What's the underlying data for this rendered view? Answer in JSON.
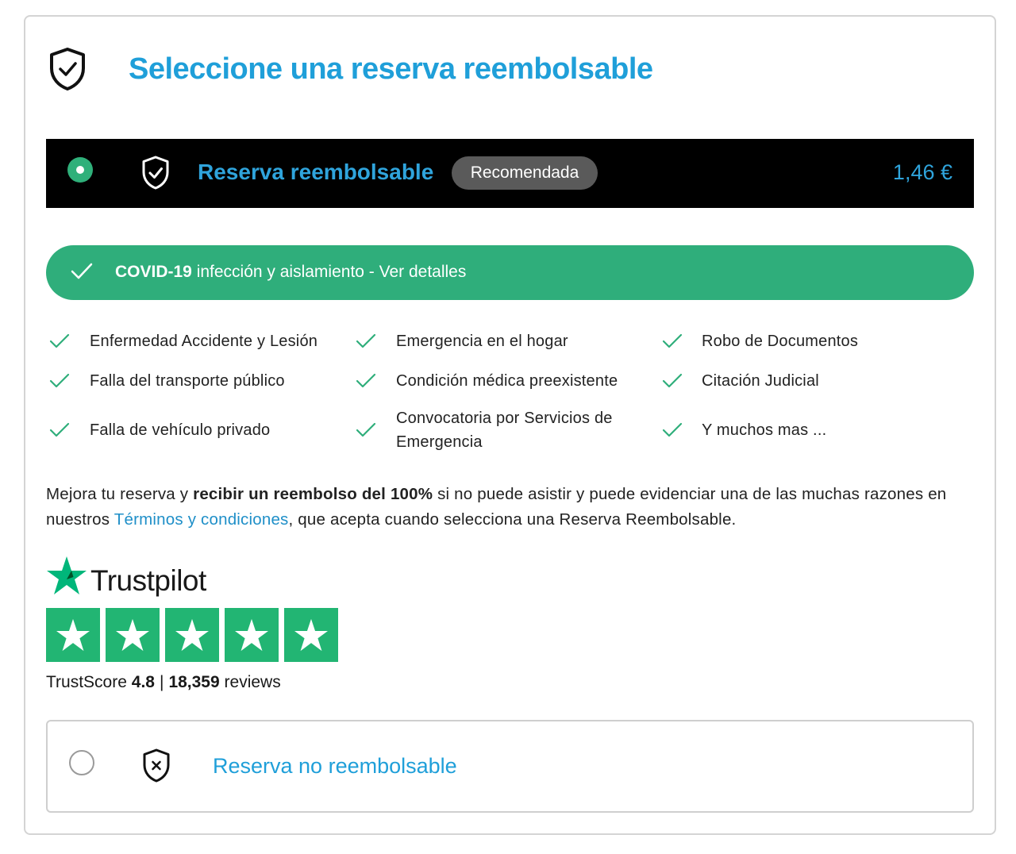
{
  "header": {
    "title": "Seleccione una reserva reembolsable",
    "icon": "shield-check-icon"
  },
  "refundable_option": {
    "title": "Reserva reembolsable",
    "badge": "Recomendada",
    "price": "1,46 €",
    "selected": true,
    "accent_color": "#2fa4dc"
  },
  "covid": {
    "bold": "COVID-19",
    "rest": " infección y aislamiento - Ver detalles",
    "bg_color": "#2fae7b"
  },
  "features": [
    [
      "Enfermedad Accidente y Lesión",
      "Emergencia en el hogar",
      "Robo de Documentos"
    ],
    [
      "Falla del transporte público",
      "Condición médica preexistente",
      "Citación Judicial"
    ],
    [
      "Falla de vehículo privado",
      "Convocatoria por Servicios de Emergencia",
      "Y muchos mas ..."
    ]
  ],
  "description": {
    "part1": "Mejora tu reserva y ",
    "bold": "recibir un reembolso del 100%",
    "part2": " si no puede asistir y puede evidenciar una de las muchas razones en nuestros ",
    "link": "Términos y condiciones",
    "part3": ", que acepta cuando selecciona una Reserva Reembolsable."
  },
  "trustpilot": {
    "brand": "Trustpilot",
    "score_label": "TrustScore",
    "score": "4.8",
    "separator": "|",
    "reviews_count": "18,359",
    "reviews_label": "reviews",
    "stars": 5,
    "star_color": "#22b573"
  },
  "non_refundable_option": {
    "title": "Reserva no reembolsable",
    "selected": false,
    "icon": "shield-x-icon"
  }
}
